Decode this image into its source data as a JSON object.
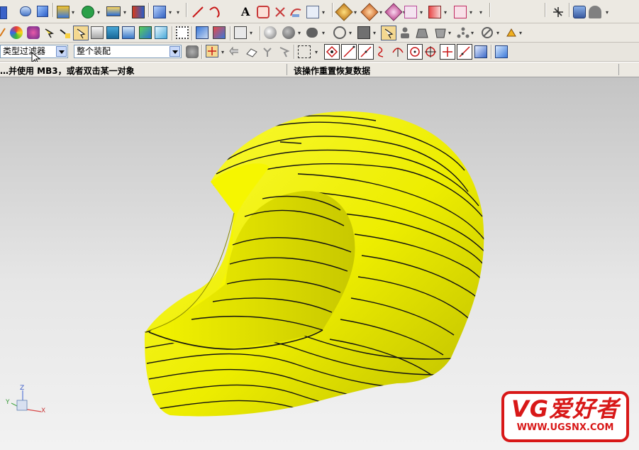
{
  "toolbar": {
    "row1_icons": [
      "view-icon",
      "cylinder-icon",
      "block-icon",
      "layer-icon",
      "shape-icon",
      "feature-icon",
      "assembly-icon",
      "solid-icon",
      "line-icon",
      "arc-icon",
      "text-icon",
      "sketch-icon",
      "mirror-icon",
      "curve-icon",
      "analysis-icon",
      "render-icon",
      "material-icon",
      "edit-icon",
      "form-icon",
      "import-icon",
      "snap-icon",
      "settings-icon",
      "help-icon"
    ],
    "row2_icons": [
      "pencil-icon",
      "color-icon",
      "brush-icon",
      "select-icon",
      "paint-icon",
      "image-icon",
      "pattern-icon",
      "cube-icon",
      "fit-icon",
      "orient-icon",
      "view3d-icon",
      "shade-icon",
      "sphere-icon",
      "ellipse-icon",
      "circle-icon",
      "no-icon",
      "square-icon",
      "highlight-icon",
      "person-icon",
      "trapezoid-icon",
      "face-icon",
      "network-icon",
      "no2-icon",
      "lamp-icon"
    ],
    "row3_icons": [
      "filter-settings-icon",
      "snap-point-icon",
      "undo-icon",
      "eraser-icon",
      "rotate-icon",
      "zoom-icon",
      "select-box-icon",
      "endpoint-icon",
      "midpoint-icon",
      "control-point-icon",
      "intersection-icon",
      "arc-center-icon",
      "quadrant-icon",
      "existing-point-icon",
      "point-on-curve-icon",
      "point-on-face-icon",
      "cube-view-icon"
    ]
  },
  "filter": {
    "type_filter_value": "类型过滤器",
    "scope_value": "整个装配"
  },
  "status": {
    "left_text": "…并使用 MB3，或者双击某一对象",
    "right_text": "该操作重置恢复数据"
  },
  "viewport": {
    "model_color": "#f2f200",
    "contour_color": "#111111",
    "background_top": "#c4c4c4",
    "background_bottom": "#f2f2f2"
  },
  "triad": {
    "x_label": "X",
    "y_label": "Y",
    "z_label": "Z"
  },
  "logo": {
    "title": "VG爱好者",
    "url": "WWW.UGSNX.COM",
    "color": "#d81818"
  }
}
